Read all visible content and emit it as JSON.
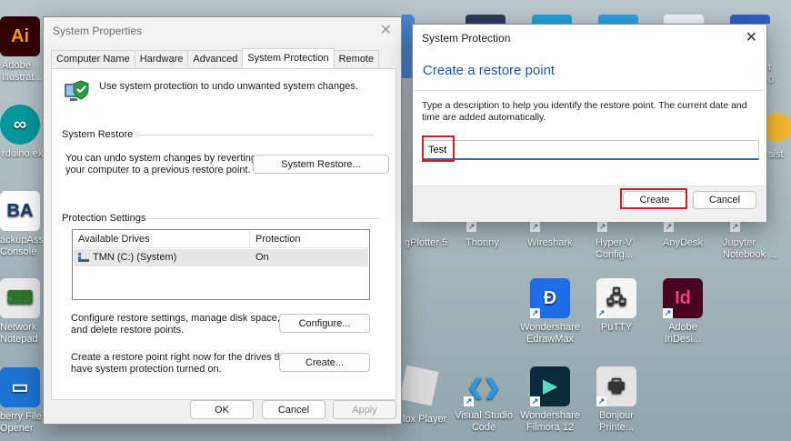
{
  "desktop": {
    "icons": [
      {
        "label": "Adobe\nIllustrat...",
        "color": "#310000",
        "fg": "#ff9a00",
        "glyph": "Ai"
      },
      {
        "label": "rduino.exe",
        "color": "#00979d",
        "fg": "#fff",
        "glyph": "∞"
      },
      {
        "label": "ackupAssis\nConsole",
        "color": "#ffffff",
        "fg": "#1a3c73",
        "glyph": "BA"
      },
      {
        "label": "Network\nNotepad",
        "color": "#e9e9e9",
        "fg": "#2d7a2d",
        "glyph": "⌨"
      },
      {
        "label": "berry File\nOpener",
        "color": "#1b74d4",
        "fg": "#fff",
        "glyph": "▭"
      },
      {
        "label": "gPlotter 5",
        "color": "",
        "fg": "",
        "glyph": ""
      },
      {
        "label": "Thonny",
        "color": "",
        "fg": "",
        "glyph": ""
      },
      {
        "label": "Wireshark",
        "color": "",
        "fg": "",
        "glyph": ""
      },
      {
        "label": "Hyper-V\nConfig...",
        "color": "",
        "fg": "",
        "glyph": ""
      },
      {
        "label": "AnyDesk",
        "color": "",
        "fg": "",
        "glyph": ""
      },
      {
        "label": "Jupyter\nNotebook ...",
        "color": "",
        "fg": "",
        "glyph": ""
      },
      {
        "label": "Wondershare\nEdrawMax",
        "color": "#1e6ce8",
        "fg": "#fff",
        "glyph": "Ð"
      },
      {
        "label": "PuTTY",
        "color": "#f4f4f4",
        "fg": "#333",
        "glyph": "🖧"
      },
      {
        "label": "Adobe\nInDesi...",
        "color": "#49021f",
        "fg": "#ff3c86",
        "glyph": "Id"
      },
      {
        "label": "lox Player",
        "color": "",
        "fg": "",
        "glyph": ""
      },
      {
        "label": "Visual Studio\nCode",
        "color": "transparent",
        "fg": "#1f9cf0",
        "glyph": "❮❯"
      },
      {
        "label": "Wondershare\nFilmora 12",
        "color": "#0b2b3a",
        "fg": "#4ee0c7",
        "glyph": "▶"
      },
      {
        "label": "Bonjour\nPrinte...",
        "color": "#e4e4e4",
        "fg": "#333",
        "glyph": "🖶"
      },
      {
        "label": "t",
        "color": "",
        "fg": "",
        "glyph": ""
      },
      {
        "label": "0",
        "color": "",
        "fg": "",
        "glyph": ""
      },
      {
        "label": "sist",
        "color": "",
        "fg": "",
        "glyph": ""
      }
    ]
  },
  "system_properties": {
    "title": "System Properties",
    "tabs": [
      "Computer Name",
      "Hardware",
      "Advanced",
      "System Protection",
      "Remote"
    ],
    "intro_text": "Use system protection to undo unwanted system changes.",
    "system_restore_group": "System Restore",
    "system_restore_desc": "You can undo system changes by reverting\nyour computer to a previous restore point.",
    "system_restore_button": "System Restore...",
    "protection_group": "Protection Settings",
    "drives_columns": [
      "Available Drives",
      "Protection"
    ],
    "drives": [
      {
        "name": "TMN (C:) (System)",
        "protection": "On"
      }
    ],
    "configure_desc": "Configure restore settings, manage disk space,\nand delete restore points.",
    "configure_button": "Configure...",
    "create_desc": "Create a restore point right now for the drives that\nhave system protection turned on.",
    "create_button": "Create...",
    "ok_button": "OK",
    "cancel_button": "Cancel",
    "apply_button": "Apply"
  },
  "restore_dialog": {
    "title": "System Protection",
    "heading": "Create a restore point",
    "description": "Type a description to help you identify the restore point. The current date and\ntime are added automatically.",
    "input_value": "Test",
    "create_button": "Create",
    "cancel_button": "Cancel",
    "highlight_color": "#d01e2a",
    "heading_color": "#1a5aa8"
  }
}
